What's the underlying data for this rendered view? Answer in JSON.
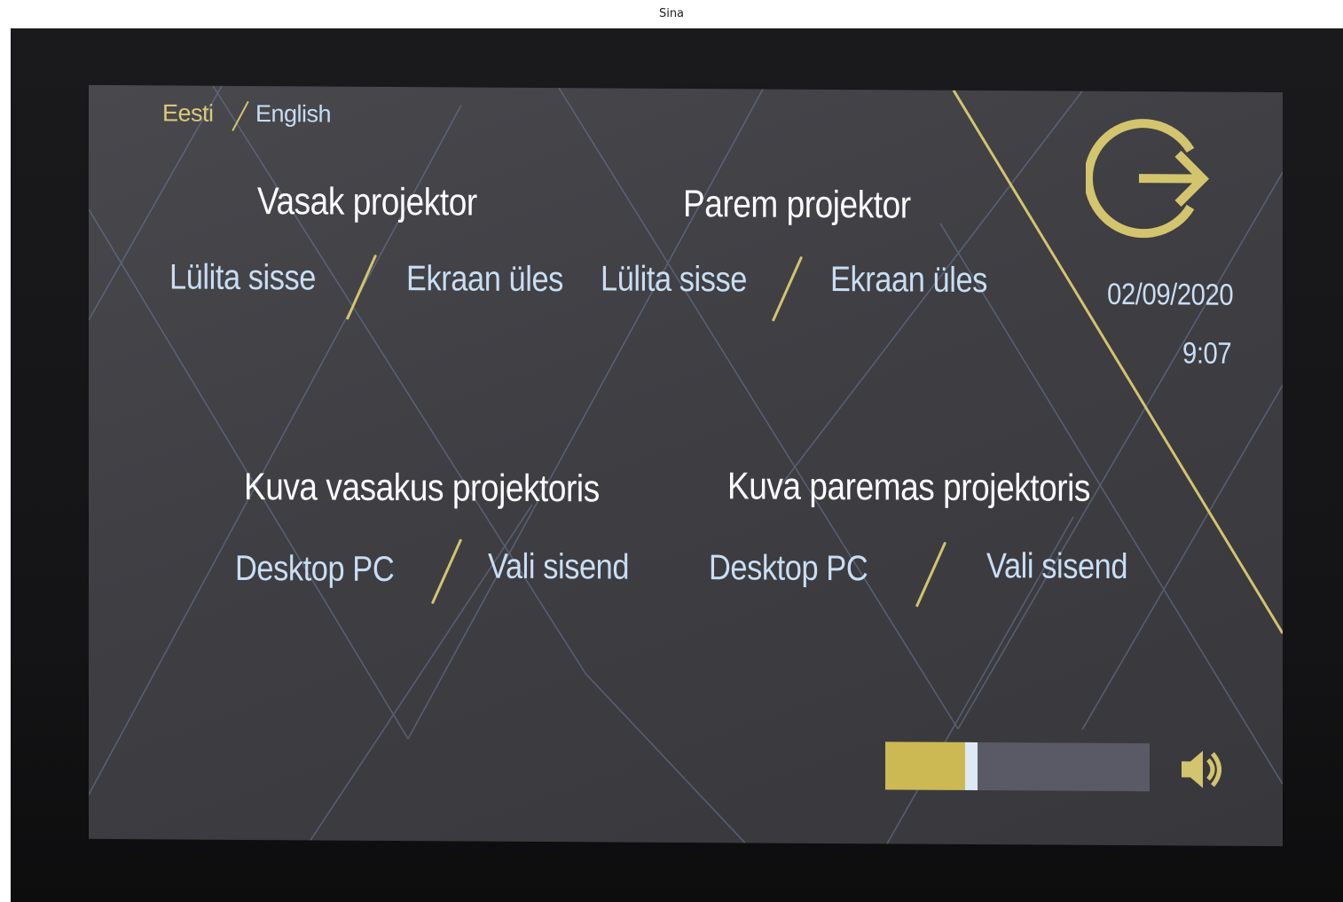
{
  "window": {
    "caller_label": "Sina"
  },
  "language": {
    "estonian": "Eesti",
    "english": "English",
    "separator": "/"
  },
  "projectors": [
    {
      "title": "Vasak projektor",
      "power_label": "Lülita sisse",
      "screen_label": "Ekraan üles"
    },
    {
      "title": "Parem projektor",
      "power_label": "Lülita sisse",
      "screen_label": "Ekraan üles"
    }
  ],
  "display_sources": [
    {
      "title": "Kuva vasakus projektoris",
      "source_label": "Desktop PC",
      "select_label": "Vali sisend"
    },
    {
      "title": "Kuva paremas projektoris",
      "source_label": "Desktop PC",
      "select_label": "Vali sisend"
    }
  ],
  "status": {
    "date": "02/09/2020",
    "time": "9:07"
  },
  "volume": {
    "level_fraction": 0.31,
    "icon": "speaker-icon"
  },
  "exit": {
    "icon": "exit-icon"
  },
  "colors": {
    "accent_gold": "#d3c46e",
    "text_blue": "#c9def3",
    "title_white": "#ffffff",
    "panel_bg": "#404045",
    "volume_track": "#5a5a66"
  }
}
